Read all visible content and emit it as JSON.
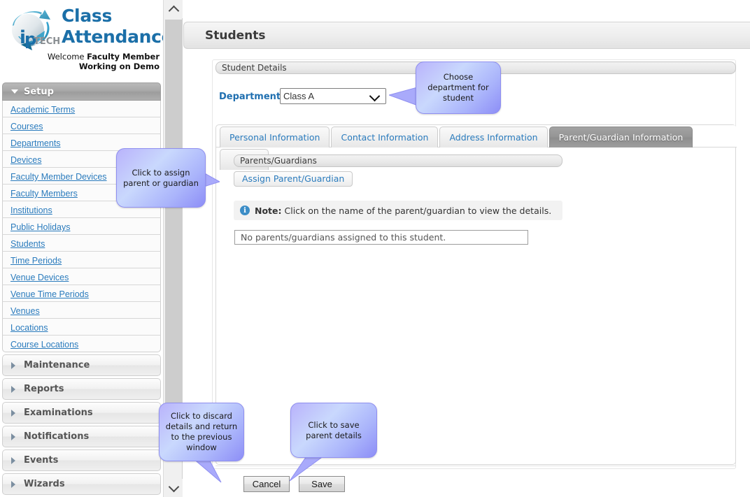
{
  "brand": {
    "logo_text": "TECH",
    "title_line1": "Class",
    "title_line2": "Attendance",
    "welcome_prefix": "Welcome ",
    "welcome_user": "Faculty Member",
    "working_on": "Working on Demo"
  },
  "sidebar": {
    "setup": {
      "label": "Setup",
      "items": [
        {
          "label": "Academic Terms"
        },
        {
          "label": "Courses"
        },
        {
          "label": "Departments"
        },
        {
          "label": "Devices"
        },
        {
          "label": "Faculty Member Devices"
        },
        {
          "label": "Faculty Members"
        },
        {
          "label": "Institutions"
        },
        {
          "label": "Public Holidays"
        },
        {
          "label": "Students"
        },
        {
          "label": "Time Periods"
        },
        {
          "label": "Venue Devices"
        },
        {
          "label": "Venue Time Periods"
        },
        {
          "label": "Venues"
        },
        {
          "label": "Locations"
        },
        {
          "label": "Course Locations"
        }
      ]
    },
    "collapsed_groups": [
      {
        "label": "Maintenance"
      },
      {
        "label": "Reports"
      },
      {
        "label": "Examinations"
      },
      {
        "label": "Notifications"
      },
      {
        "label": "Events"
      },
      {
        "label": "Wizards"
      }
    ]
  },
  "main": {
    "page_title": "Students",
    "student_details_section": "Student Details",
    "department": {
      "label": "Department",
      "value": "Class A",
      "options": [
        "Class A"
      ]
    },
    "tabs": [
      {
        "label": "Personal Information",
        "active": false
      },
      {
        "label": "Contact Information",
        "active": false
      },
      {
        "label": "Address Information",
        "active": false
      },
      {
        "label": "Parent/Guardian Information",
        "active": true
      }
    ],
    "parents_section": "Parents/Guardians",
    "assign_button": "Assign Parent/Guardian",
    "note": {
      "icon": "info-icon",
      "bold_prefix": "Note:",
      "text": " Click on the name of the parent/guardian to view the details."
    },
    "empty_state": "No parents/guardians assigned to this student.",
    "buttons": {
      "cancel": "Cancel",
      "save": "Save"
    }
  },
  "callouts": {
    "department": "Choose department for student",
    "assign": "Click to assign parent or guardian",
    "cancel": "Click to discard details and return to the previous window",
    "save": "Click to save parent details"
  },
  "colors": {
    "brand_blue": "#1b6fa8",
    "link_blue": "#2a7bbd",
    "callout_purple": "#8d8ef7",
    "active_tab_gray": "#949494",
    "info_icon_blue": "#3c8dc7"
  }
}
